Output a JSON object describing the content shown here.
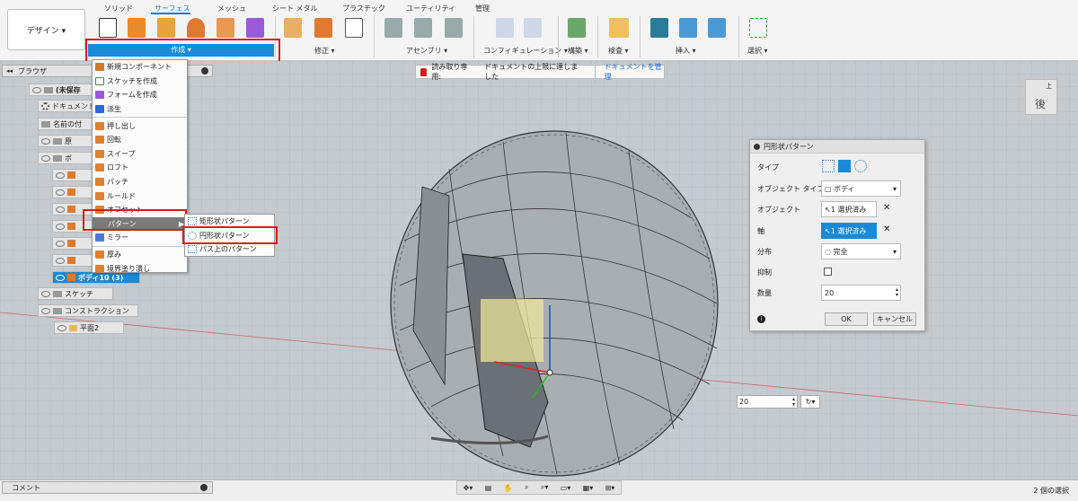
{
  "toolbar": {
    "workspace": "デザイン ▾",
    "tabs": [
      "ソリッド",
      "サーフェス",
      "メッシュ",
      "シート メタル",
      "プラスチック",
      "ユーティリティ",
      "管理"
    ],
    "groups": [
      "作成 ▾",
      "修正 ▾",
      "アセンブリ ▾",
      "コンフィギュレーション ▾",
      "構築 ▾",
      "検査 ▾",
      "挿入 ▾",
      "選択 ▾"
    ],
    "accent": "#1a8ad8"
  },
  "browser": {
    "title": "ブラウザ",
    "rows": [
      {
        "label": "(未保存",
        "type": "doc"
      },
      {
        "label": "ドキュメント",
        "type": "gear"
      },
      {
        "label": "名前の付",
        "type": "folder"
      },
      {
        "label": "原",
        "type": "folder"
      },
      {
        "label": "ボ",
        "type": "folder"
      },
      {
        "label": "",
        "type": "body"
      },
      {
        "label": "",
        "type": "body"
      },
      {
        "label": "",
        "type": "body"
      },
      {
        "label": "",
        "type": "body"
      },
      {
        "label": "",
        "type": "body"
      },
      {
        "label": "",
        "type": "body"
      },
      {
        "label": "ボディ10 (3)",
        "type": "body-selected"
      },
      {
        "label": "スケッチ",
        "type": "folder"
      },
      {
        "label": "コンストラクション",
        "type": "folder"
      },
      {
        "label": "平面2",
        "type": "plane"
      }
    ]
  },
  "create_menu": {
    "items": [
      {
        "label": "新規コンポーネント",
        "color": "#d07a30"
      },
      {
        "label": "スケッチを作成",
        "color": "#4a8a4a"
      },
      {
        "label": "フォームを作成",
        "color": "#9a5ad8"
      },
      {
        "label": "派生",
        "color": "#2a6ad8"
      },
      {
        "label": "押し出し",
        "color": "#e08030"
      },
      {
        "label": "回転",
        "color": "#e08030"
      },
      {
        "label": "スイープ",
        "color": "#e08030"
      },
      {
        "label": "ロフト",
        "color": "#e08030"
      },
      {
        "label": "パッチ",
        "color": "#e08030"
      },
      {
        "label": "ルールド",
        "color": "#e08030"
      },
      {
        "label": "オフセット",
        "color": "#e08030"
      },
      {
        "label": "パターン",
        "color": "#888888"
      },
      {
        "label": "ミラー",
        "color": "#4a7ad8"
      },
      {
        "label": "厚み",
        "color": "#e08030"
      },
      {
        "label": "境界塗り潰し",
        "color": "#e08030"
      }
    ],
    "pattern_submenu": [
      "矩形状パターン",
      "円形状パターン",
      "パス上のパターン"
    ]
  },
  "readonly_banner": {
    "label": "読み取り専用:",
    "message": "ドキュメントの上限に達しました",
    "link": "ドキュメントを管理"
  },
  "dialog": {
    "title": "円形状パターン",
    "type_label": "タイプ",
    "object_type_label": "オブジェクト タイプ",
    "object_type_value": "ボディ",
    "objects_label": "オブジェクト",
    "objects_value": "1 選択済み",
    "axis_label": "軸",
    "axis_value": "1 選択済み",
    "distribution_label": "分布",
    "distribution_value": "完全",
    "suppress_label": "抑制",
    "quantity_label": "数量",
    "quantity_value": "20",
    "ok": "OK",
    "cancel": "キャンセル"
  },
  "viewcube": {
    "top": "上",
    "face": "後"
  },
  "canvas_input": {
    "value": "20"
  },
  "footer": {
    "comment": "コメント",
    "status": "2 個の選択"
  }
}
